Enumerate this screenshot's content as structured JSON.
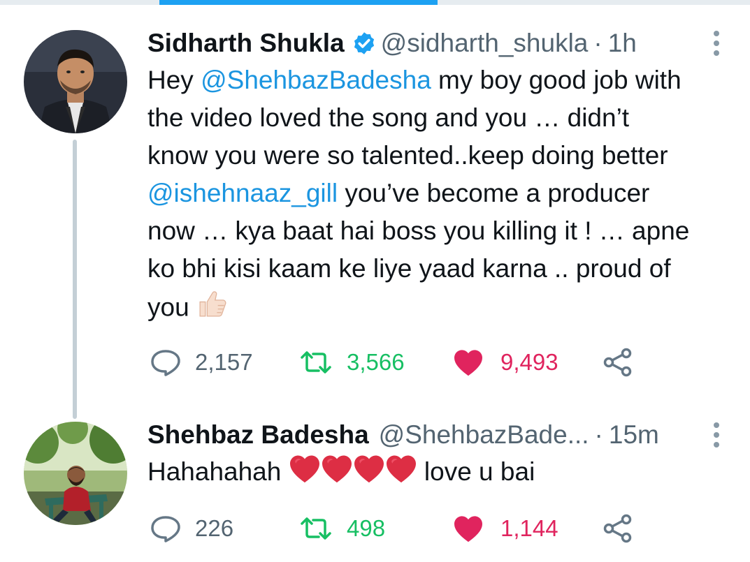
{
  "colors": {
    "accent": "#1da1f2",
    "mention": "#1b95e0",
    "retweet": "#17bf63",
    "like": "#e0245e",
    "muted": "#536471",
    "text": "#0f1419"
  },
  "tweets": [
    {
      "display_name": "Sidharth Shukla",
      "verified": true,
      "handle": "@sidharth_shukla",
      "separator": "·",
      "time": "1h",
      "lines": [
        [
          {
            "t": "Hey "
          },
          {
            "m": "@ShehbazBadesha"
          },
          {
            "t": " my boy good job with"
          }
        ],
        [
          {
            "t": "the video loved the song and you … didn’t"
          }
        ],
        [
          {
            "t": "know you were so talented..keep doing better"
          }
        ],
        [
          {
            "m": "@ishehnaaz_gill"
          },
          {
            "t": " you’ve become a producer"
          }
        ],
        [
          {
            "t": "now … kya baat hai boss you killing it ! … apne"
          }
        ],
        [
          {
            "t": "ko bhi kisi kaam ke liye yaad karna .. proud of"
          }
        ],
        [
          {
            "t": "you "
          },
          {
            "e": "thumbs-up"
          }
        ]
      ],
      "reply_count": "2,157",
      "retweet_count": "3,566",
      "like_count": "9,493"
    },
    {
      "display_name": "Shehbaz Badesha",
      "verified": false,
      "handle": "@ShehbazBade...",
      "separator": "·",
      "time": "15m",
      "lines": [
        [
          {
            "t": "Hahahahah "
          },
          {
            "e": "heart"
          },
          {
            "e": "heart"
          },
          {
            "e": "heart"
          },
          {
            "e": "heart"
          },
          {
            "t": " love u bai"
          }
        ]
      ],
      "reply_count": "226",
      "retweet_count": "498",
      "like_count": "1,144"
    }
  ]
}
